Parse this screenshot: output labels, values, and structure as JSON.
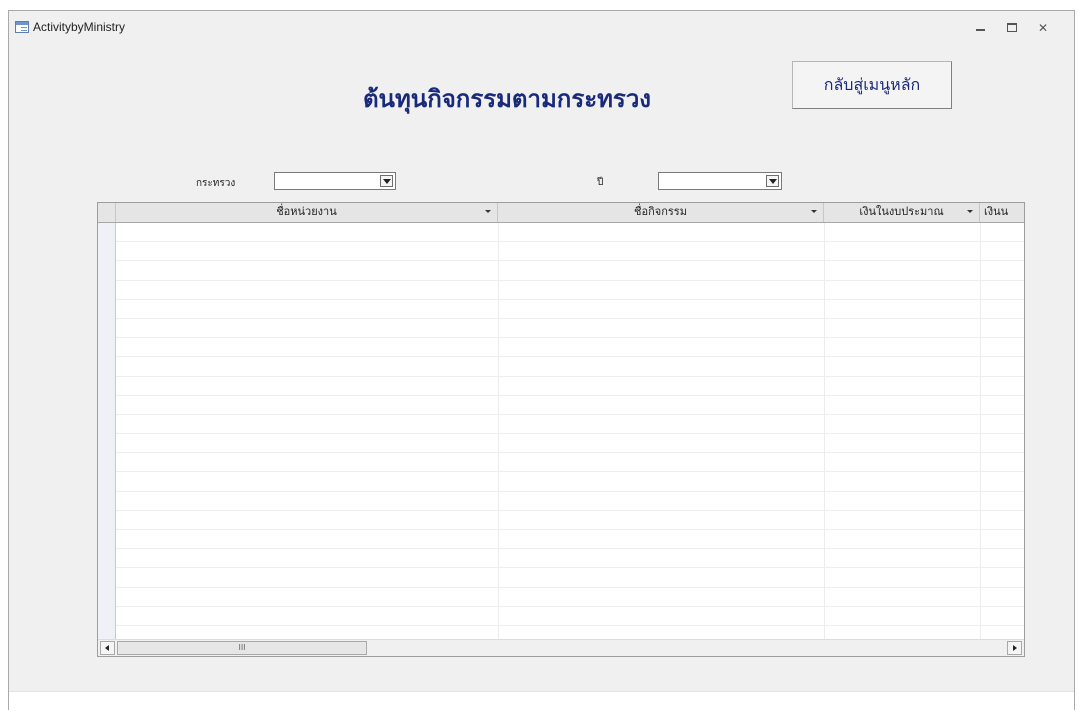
{
  "window": {
    "title": "ActivitybyMinistry"
  },
  "form": {
    "title": "ต้นทุนกิจกรรมตามกระทรวง",
    "back_button_label": "กลับสู่เมนูหลัก",
    "filters": {
      "ministry_label": "กระทรวง",
      "ministry_value": "",
      "year_label": "ปี",
      "year_value": ""
    }
  },
  "grid": {
    "columns": [
      {
        "label": "ชื่อหน่วยงาน"
      },
      {
        "label": "ชื่อกิจกรรม"
      },
      {
        "label": "เงินในงบประมาณ"
      },
      {
        "label": "เงินน"
      }
    ],
    "rows": []
  },
  "scrollbar": {
    "thumb_grip": "III"
  },
  "icons": {
    "window": "form-icon",
    "minimize": "minimize-icon",
    "maximize": "maximize-icon",
    "close": "close-icon"
  }
}
